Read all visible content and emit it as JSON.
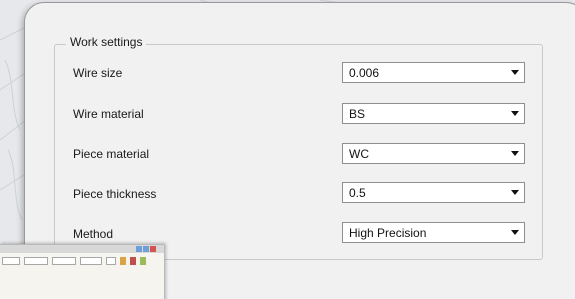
{
  "work_settings": {
    "title": "Work settings",
    "rows": [
      {
        "label": "Wire size",
        "value": "0.006"
      },
      {
        "label": "Wire material",
        "value": "BS"
      },
      {
        "label": "Piece material",
        "value": "WC"
      },
      {
        "label": "Piece thickness",
        "value": "0.5"
      },
      {
        "label": "Method",
        "value": "High Precision"
      }
    ]
  },
  "icons": {
    "dropdown": "chevron-down-icon",
    "thumbnail_buttons": "window-controls-icon"
  },
  "colors": {
    "panel_background": "#f1f1f1",
    "panel_border": "#9a9a9a",
    "group_border": "#c9c9c9",
    "field_border": "#8e8e8e"
  }
}
